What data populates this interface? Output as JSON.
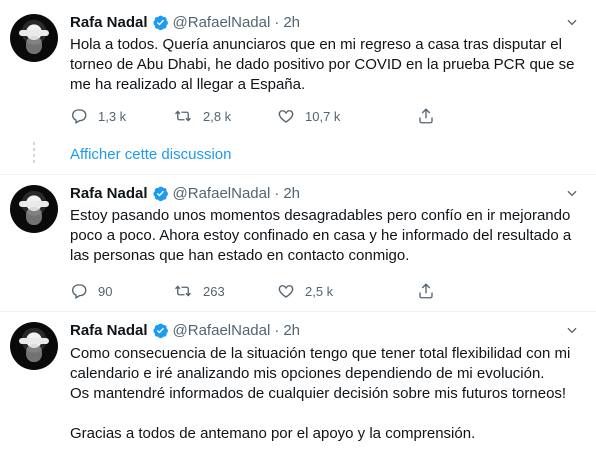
{
  "tweets": [
    {
      "name": "Rafa Nadal",
      "handle": "@RafaelNadal",
      "dot": "·",
      "time": "2h",
      "lines": [
        "Hola a todos. Quería anunciaros que en mi regreso a casa tras disputar el",
        "torneo de Abu Dhabi, he dado positivo por COVID en la prueba PCR que se",
        "me ha realizado al llegar a España."
      ],
      "replies": "1,3 k",
      "retweets": "2,8 k",
      "likes": "10,7 k"
    },
    {
      "name": "Rafa Nadal",
      "handle": "@RafaelNadal",
      "dot": "·",
      "time": "2h",
      "lines": [
        "Estoy pasando unos momentos desagradables pero confío en ir mejorando",
        "poco a poco. Ahora estoy confinado en casa y he informado del resultado a",
        "las personas que han estado en contacto conmigo."
      ],
      "replies": "90",
      "retweets": "263",
      "likes": "2,5 k"
    },
    {
      "name": "Rafa Nadal",
      "handle": "@RafaelNadal",
      "dot": "·",
      "time": "2h",
      "lines": [
        "Como consecuencia de la situación tengo que tener total flexibilidad con mi",
        "calendario e iré analizando mis opciones dependiendo de mi evolución.",
        "Os mantendré informados de cualquier decisión sobre mis futuros torneos!",
        "",
        "Gracias a todos de antemano por el apoyo y la comprensión."
      ]
    }
  ],
  "show_thread": "Afficher cette discussion",
  "colors": {
    "accent": "#1d9bf0",
    "muted": "#536471",
    "text": "#0f1419"
  },
  "icons": [
    "verified-badge-icon",
    "more-caret-icon",
    "reply-icon",
    "retweet-icon",
    "like-icon",
    "share-icon"
  ]
}
